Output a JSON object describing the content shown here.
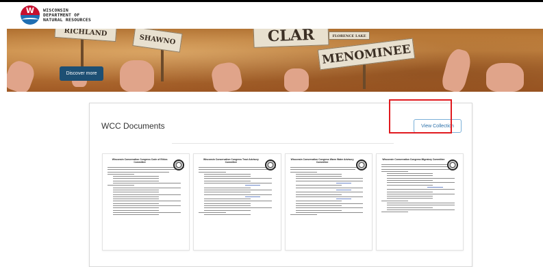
{
  "header": {
    "logo_lines": [
      "WISCONSIN",
      "DEPARTMENT OF",
      "NATURAL RESOURCES"
    ]
  },
  "hero": {
    "signs": [
      "RICHLAND",
      "SHAWNO",
      "CLAR",
      "FLORENCE LAKE",
      "MENOMINEE"
    ],
    "discover_label": "Discover more"
  },
  "documents": {
    "title": "WCC Documents",
    "view_collection_label": "View Collection",
    "items": [
      {
        "heading": "Wisconsin Conservation Congress Code of Ethics Committee"
      },
      {
        "heading": "Wisconsin Conservation Congress Trout Advisory Committee"
      },
      {
        "heading": "Wisconsin Conservation Congress Warm Water Advisory Committee"
      },
      {
        "heading": "Wisconsin Conservation Congress Migratory Committee"
      }
    ]
  },
  "colors": {
    "accent": "#1d4f73",
    "link": "#2a6fa8",
    "highlight": "#e0191e"
  }
}
